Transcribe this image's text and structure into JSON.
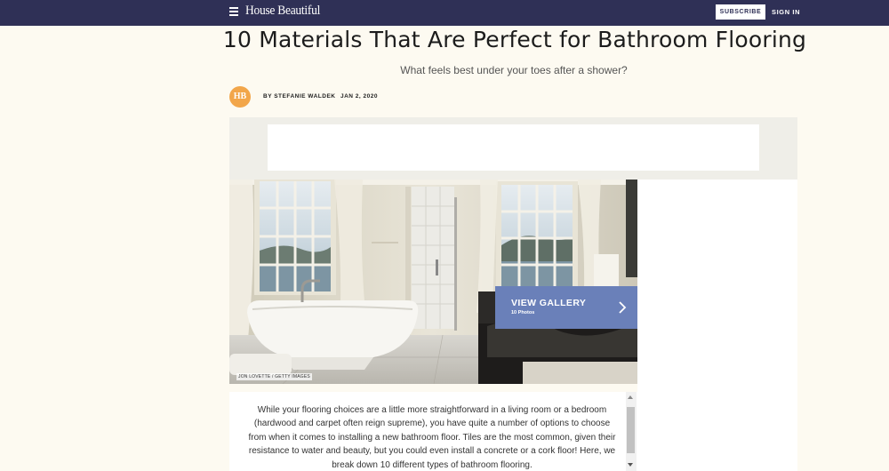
{
  "nav": {
    "logo": "House Beautiful",
    "menu_icon": "hamburger-menu-icon",
    "subscribe_label": "SUBSCRIBE",
    "signin_label": "SIGN IN",
    "bar_color": "#2f3056"
  },
  "article": {
    "title": "10 Materials That Are Perfect for Bathroom Flooring",
    "dek": "What feels best under your toes after a shower?",
    "avatar_initials": "HB",
    "byline": "BY STEFANIE WALDEK",
    "date": "JAN 2, 2020",
    "photo_credit": "JON LOVETTE / GETTY IMAGES",
    "gallery": {
      "label": "VIEW GALLERY",
      "count": "10 Photos",
      "icon": "chevron-right-icon",
      "color": "#6a80b9"
    },
    "intro": "While your flooring choices are a little more straightforward in a living room or a bedroom (hardwood and carpet often reign supreme), you have quite a number of options to choose from when it comes to installing a new bathroom floor. Tiles are the most common, given their resistance to water and beauty, but you could even install a concrete or a cork floor! Here, we break down 10 different types of bathroom flooring."
  },
  "colors": {
    "background": "#fdfaf1",
    "avatar": "#f2a64a"
  }
}
